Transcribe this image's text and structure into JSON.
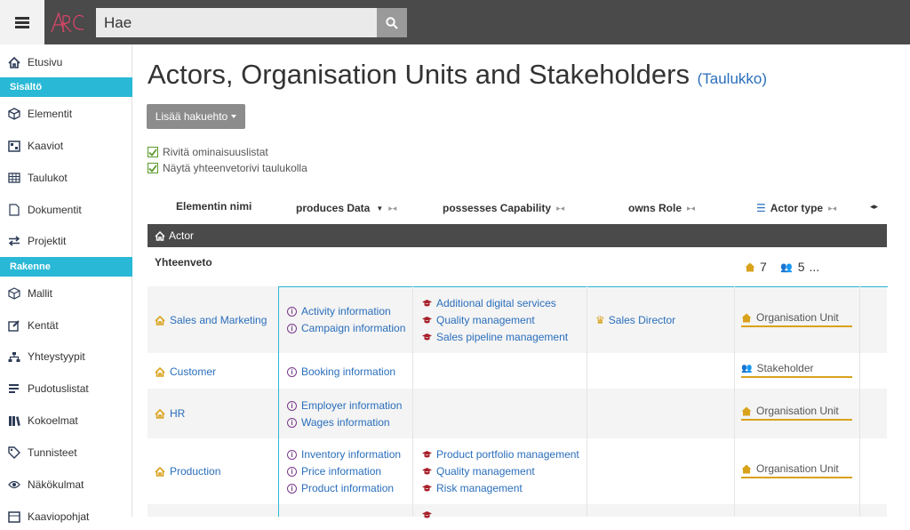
{
  "search": {
    "placeholder": "Hae"
  },
  "sidebar": {
    "items": [
      {
        "label": "Etusivu",
        "icon": "home-icon"
      },
      {
        "label": "Elementit",
        "icon": "cube-icon"
      },
      {
        "label": "Kaaviot",
        "icon": "diagram-icon"
      },
      {
        "label": "Taulukot",
        "icon": "table-icon"
      },
      {
        "label": "Dokumentit",
        "icon": "document-icon"
      },
      {
        "label": "Projektit",
        "icon": "exchange-icon"
      },
      {
        "label": "Mallit",
        "icon": "box-icon"
      },
      {
        "label": "Kentät",
        "icon": "edit-icon"
      },
      {
        "label": "Yhteystyypit",
        "icon": "sitemap-icon"
      },
      {
        "label": "Pudotuslistat",
        "icon": "list-icon"
      },
      {
        "label": "Kokoelmat",
        "icon": "books-icon"
      },
      {
        "label": "Tunnisteet",
        "icon": "tag-icon"
      },
      {
        "label": "Näkökulmat",
        "icon": "eye-icon"
      },
      {
        "label": "Kaaviopohjat",
        "icon": "template-icon"
      }
    ],
    "sections": {
      "content": "Sisältö",
      "structure": "Rakenne"
    }
  },
  "page": {
    "title": "Actors, Organisation Units and Stakeholders",
    "subtitle": "(Taulukko)",
    "add_button": "Lisää hakuehto",
    "checkbox_wrap": "Rivitä ominaisuuslistat",
    "checkbox_summary": "Näytä yhteenvetorivi taulukolla"
  },
  "table": {
    "headers": {
      "name": "Elementin nimi",
      "produces": "produces Data",
      "possesses": "possesses Capability",
      "owns": "owns Role",
      "type": "Actor type"
    },
    "group": "Actor",
    "summary": {
      "label": "Yhteenveto",
      "ou_count": "7",
      "sh_count": "5",
      "more": "..."
    },
    "rows": [
      {
        "name": "Sales and Marketing",
        "data": [
          "Activity information",
          "Campaign information"
        ],
        "caps": [
          "Additional digital services",
          "Quality management",
          "Sales pipeline management"
        ],
        "role": "Sales Director",
        "type": "Organisation Unit"
      },
      {
        "name": "Customer",
        "data": [
          "Booking information"
        ],
        "caps": [],
        "role": "",
        "type": "Stakeholder"
      },
      {
        "name": "HR",
        "data": [
          "Employer information",
          "Wages information"
        ],
        "caps": [],
        "role": "",
        "type": "Organisation Unit"
      },
      {
        "name": "Production",
        "data": [
          "Inventory information",
          "Price information",
          "Product information"
        ],
        "caps": [
          "Product portfolio management",
          "Quality management",
          "Risk management"
        ],
        "role": "",
        "type": "Organisation Unit"
      }
    ]
  }
}
